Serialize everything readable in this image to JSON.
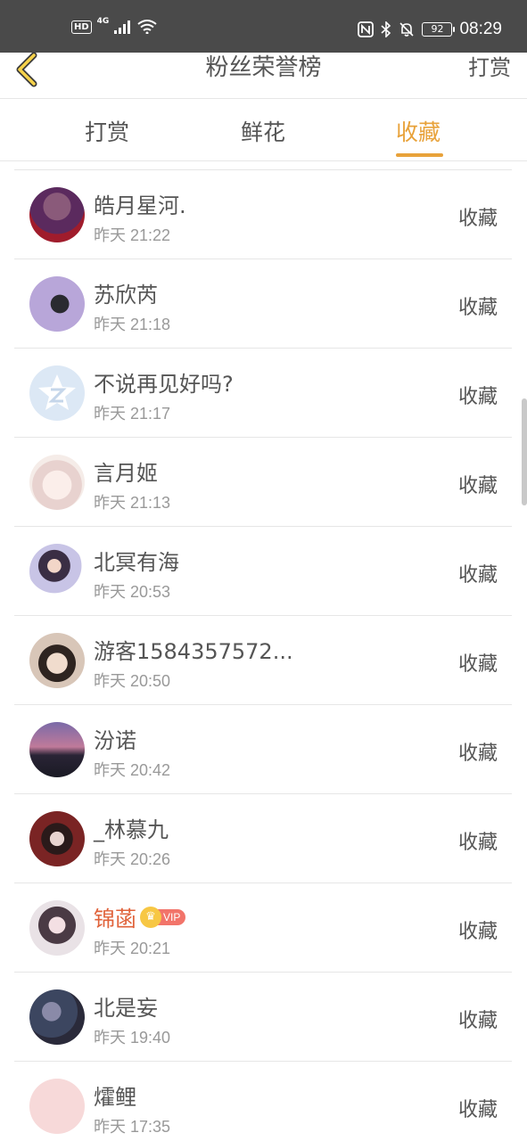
{
  "status_bar": {
    "hd": "HD",
    "network": "4G",
    "battery": "92",
    "time": "08:29"
  },
  "header": {
    "title": "粉丝荣誉榜",
    "right_link": "打赏"
  },
  "tabs": [
    {
      "label": "打赏",
      "active": false
    },
    {
      "label": "鲜花",
      "active": false
    },
    {
      "label": "收藏",
      "active": true
    }
  ],
  "accent_color": "#e8a23a",
  "list": [
    {
      "name": "皓月星河.",
      "time": "昨天 21:22",
      "action": "收藏",
      "vip": false,
      "avatar_color": "#5b2a5e"
    },
    {
      "name": "苏欣芮",
      "time": "昨天 21:18",
      "action": "收藏",
      "vip": false,
      "avatar_color": "#b8a6d9"
    },
    {
      "name": "不说再见好吗?",
      "time": "昨天 21:17",
      "action": "收藏",
      "vip": false,
      "avatar_color": "#dce8f5"
    },
    {
      "name": "言月姬",
      "time": "昨天 21:13",
      "action": "收藏",
      "vip": false,
      "avatar_color": "#f3e4e2"
    },
    {
      "name": "北冥有海",
      "time": "昨天 20:53",
      "action": "收藏",
      "vip": false,
      "avatar_color": "#c8c4e6"
    },
    {
      "name": "游客1584357572...",
      "time": "昨天 20:50",
      "action": "收藏",
      "vip": false,
      "avatar_color": "#d8c6b8"
    },
    {
      "name": "汾诺",
      "time": "昨天 20:42",
      "action": "收藏",
      "vip": false,
      "avatar_color": "#6a5a8a"
    },
    {
      "name": "_林慕九",
      "time": "昨天 20:26",
      "action": "收藏",
      "vip": false,
      "avatar_color": "#7a2424"
    },
    {
      "name": "锦菡",
      "time": "昨天 20:21",
      "action": "收藏",
      "vip": true,
      "vip_label": "VIP",
      "avatar_color": "#4a3a44"
    },
    {
      "name": "北是妄",
      "time": "昨天 19:40",
      "action": "收藏",
      "vip": false,
      "avatar_color": "#3c4660"
    },
    {
      "name": "㸌鲤",
      "time": "昨天 17:35",
      "action": "收藏",
      "vip": false,
      "avatar_color": "#f7d9d9"
    }
  ]
}
